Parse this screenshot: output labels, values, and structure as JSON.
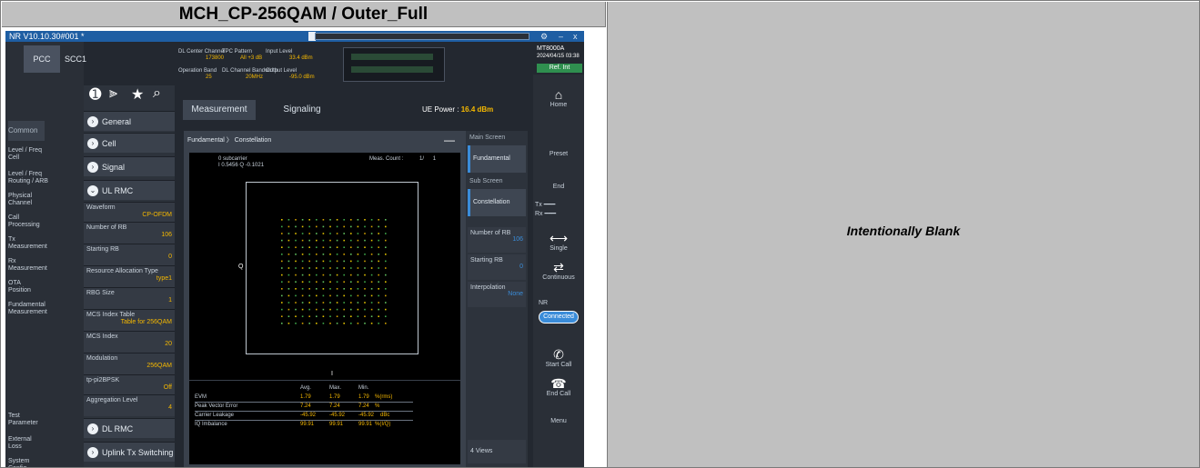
{
  "header": {
    "title": "MCH_CP-256QAM / Outer_Full"
  },
  "right_pane": {
    "text": "Intentionally Blank"
  },
  "window": {
    "title": "NR V10.10.30#001 *",
    "controls": {
      "settings": "⚙",
      "min": "–",
      "close": "x"
    }
  },
  "top_tabs": [
    "PCC",
    "SCC1"
  ],
  "left_nav": {
    "common": "Common",
    "items": [
      "Level / Freq\nCell",
      "Level / Freq\nRouting / ARB",
      "Physical\nChannel",
      "Call\nProcessing",
      "Tx\nMeasurement",
      "Rx\nMeasurement",
      "OTA\nPosition",
      "Fundamental\nMeasurement"
    ],
    "bottom_items": [
      "Test\nParameter",
      "External\nLoss",
      "System\nConfig"
    ]
  },
  "toolbar": {
    "icons": [
      "chevron-icon",
      "tree-icon",
      "star-icon",
      "search-icon"
    ]
  },
  "groups": [
    "General",
    "Cell",
    "Signal",
    "UL RMC",
    "DL RMC",
    "Uplink Tx Switching"
  ],
  "params": [
    {
      "label": "Waveform",
      "value": "CP-OFDM"
    },
    {
      "label": "Number of RB",
      "value": "106"
    },
    {
      "label": "Starting RB",
      "value": "0"
    },
    {
      "label": "Resource Allocation Type",
      "value": "type1"
    },
    {
      "label": "RBG Size",
      "value": "1"
    },
    {
      "label": "MCS Index Table",
      "value": "Table for 256QAM"
    },
    {
      "label": "MCS Index",
      "value": "20"
    },
    {
      "label": "Modulation",
      "value": "256QAM"
    },
    {
      "label": "tp-pi2BPSK",
      "value": "Off"
    },
    {
      "label": "Aggregation Level",
      "value": "4"
    }
  ],
  "status_info": [
    {
      "label": "DL Center Channel",
      "value": "173800"
    },
    {
      "label": "TPC Pattern",
      "value": "All +3 dB"
    },
    {
      "label": "Input Level",
      "value": "33.4 dBm"
    },
    {
      "label": "Operation Band",
      "value": "25"
    },
    {
      "label": "DL Channel Bandwidth",
      "value": "20MHz"
    },
    {
      "label": "Output Level",
      "value": "-95.0 dBm"
    }
  ],
  "instrument": {
    "model": "MT8000A",
    "date": "2024/04/15 03:38",
    "ref": "Ref. Int"
  },
  "main_tabs": [
    "Measurement",
    "Signaling"
  ],
  "ue_power": {
    "label": "UE Power :",
    "value": "16.4 dBm"
  },
  "plot_panel": {
    "breadcrumb": "Fundamental 〉 Constellation",
    "marker": "0 subcarrier\nI 0.5456 Q -0.1021",
    "meas_count_label": "Meas. Count :",
    "meas_count": "1/",
    "meas_count_total": "1",
    "q_axis": "Q",
    "i_axis": "I"
  },
  "stats": {
    "headers": [
      "Avg.",
      "Max.",
      "Min."
    ],
    "rows": [
      {
        "name": "EVM",
        "avg": "1.79",
        "max": "1.79",
        "min": "1.79",
        "unit": "%(rms)"
      },
      {
        "name": "Peak Vector Error",
        "avg": "7.24",
        "max": "7.24",
        "min": "7.24",
        "unit": "%"
      },
      {
        "name": "Carrier Leakage",
        "avg": "-45.92",
        "max": "-45.92",
        "min": "-45.92",
        "unit": "dBc"
      },
      {
        "name": "IQ Imbalance",
        "avg": "99.91",
        "max": "99.91",
        "min": "99.91",
        "unit": "%(I/Q)"
      }
    ]
  },
  "right_panel": {
    "main_screen": "Main Screen",
    "main_value": "Fundamental",
    "sub_screen": "Sub Screen",
    "sub_value": "Constellation",
    "num_rb": {
      "label": "Number of RB",
      "value": "106"
    },
    "starting_rb": {
      "label": "Starting RB",
      "value": "0"
    },
    "interp": {
      "label": "Interpolation",
      "value": "None"
    },
    "views": "4 Views"
  },
  "func_keys": {
    "home": "Home",
    "preset": "Preset",
    "end": "End",
    "tx": "Tx",
    "rx": "Rx",
    "single": "Single",
    "continuous": "Continuous",
    "nr": "NR",
    "connected": "Connected",
    "start_call": "Start Call",
    "end_call": "End Call",
    "menu": "Menu"
  }
}
